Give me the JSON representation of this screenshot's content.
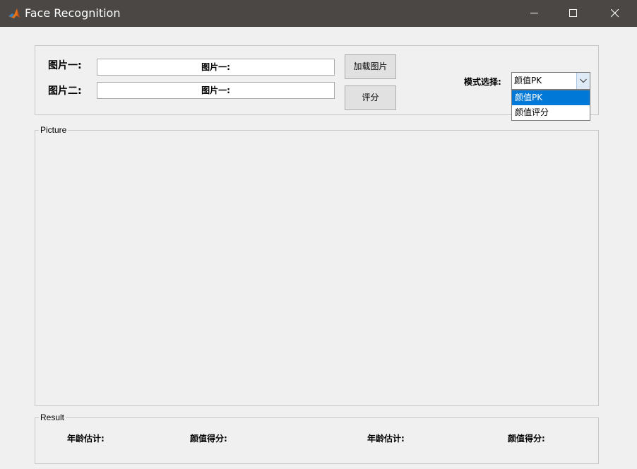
{
  "window": {
    "title": "Face Recognition",
    "icon": "matlab-icon",
    "controls": [
      "minimize-icon",
      "maximize-icon",
      "close-icon"
    ]
  },
  "top_panel": {
    "image1_label": "图片一:",
    "image2_label": "图片二:",
    "image1_field": "图片一:",
    "image2_field": "图片一:",
    "load_button": "加载图片",
    "score_button": "评分",
    "mode_label": "模式选择:",
    "mode_select": {
      "value": "颜值PK",
      "options": [
        "颜值PK",
        "颜值评分"
      ],
      "highlighted": "颜值PK"
    }
  },
  "picture_panel": {
    "title": "Picture"
  },
  "result_panel": {
    "title": "Result",
    "labels": [
      "年龄估计:",
      "颜值得分:",
      "年龄估计:",
      "颜值得分:"
    ]
  },
  "colors": {
    "titlebar": "#4a4744",
    "background": "#f0f0f0",
    "selection": "#0078d7"
  }
}
